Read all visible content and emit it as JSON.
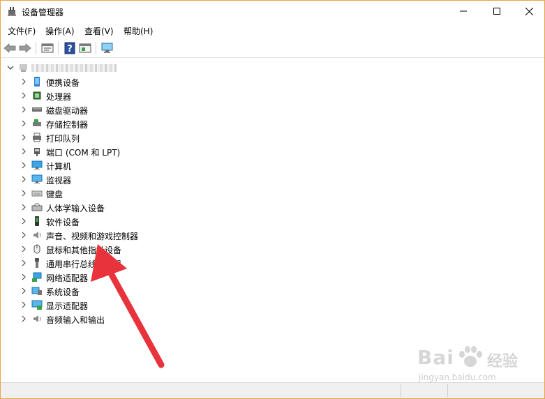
{
  "window": {
    "title": "设备管理器",
    "minimize_label": "minimize-icon",
    "maximize_label": "maximize-icon",
    "close_label": "close-icon"
  },
  "menu": [
    "文件(F)",
    "操作(A)",
    "查看(V)",
    "帮助(H)"
  ],
  "toolbar_icons": [
    "back-icon",
    "forward-icon",
    "properties-icon",
    "help-icon",
    "view-icon",
    "monitor-scan-icon"
  ],
  "tree": {
    "categories": [
      {
        "label": "便携设备",
        "icon": "portable-device-icon"
      },
      {
        "label": "处理器",
        "icon": "processor-icon"
      },
      {
        "label": "磁盘驱动器",
        "icon": "disk-drive-icon"
      },
      {
        "label": "存储控制器",
        "icon": "storage-controller-icon"
      },
      {
        "label": "打印队列",
        "icon": "printer-icon"
      },
      {
        "label": "端口 (COM 和 LPT)",
        "icon": "port-icon"
      },
      {
        "label": "计算机",
        "icon": "computer-icon"
      },
      {
        "label": "监视器",
        "icon": "monitor-icon"
      },
      {
        "label": "键盘",
        "icon": "keyboard-icon"
      },
      {
        "label": "人体学输入设备",
        "icon": "hid-icon"
      },
      {
        "label": "软件设备",
        "icon": "software-device-icon"
      },
      {
        "label": "声音、视频和游戏控制器",
        "icon": "speaker-icon"
      },
      {
        "label": "鼠标和其他指针设备",
        "icon": "mouse-icon"
      },
      {
        "label": "通用串行总线控制器",
        "icon": "usb-icon"
      },
      {
        "label": "网络适配器",
        "icon": "network-adapter-icon"
      },
      {
        "label": "系统设备",
        "icon": "system-device-icon"
      },
      {
        "label": "显示适配器",
        "icon": "display-adapter-icon"
      },
      {
        "label": "音频输入和输出",
        "icon": "audio-io-icon"
      }
    ]
  },
  "watermark": {
    "brand": "Bai",
    "jingyan": "经验",
    "url": "jingyan.baidu.com"
  },
  "colors": {
    "window_border": "#e8a64b",
    "annotation_arrow": "#e8323c",
    "folder_blue": "#2b7cd3"
  }
}
